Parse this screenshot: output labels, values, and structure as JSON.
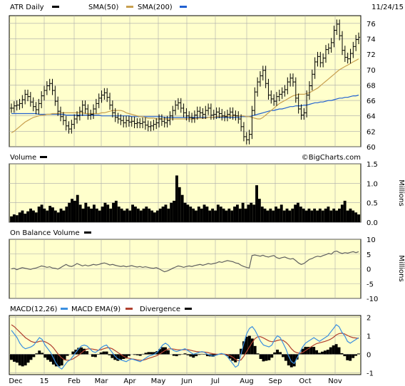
{
  "chart_data": {
    "type": "stock-panels",
    "date": "11/24/15",
    "credit": "©BigCharts.com",
    "x_tick_labels": [
      "Dec",
      "15",
      "Feb",
      "Mar",
      "Apr",
      "May",
      "Jun",
      "Jul",
      "Aug",
      "Sep",
      "Oct",
      "Nov"
    ],
    "colors": {
      "bg": "#ffffcc",
      "price": "#000000",
      "sma50": "#c8a050",
      "sma200": "#2060d0",
      "obv": "#606060",
      "macd": "#3a8fe0",
      "ema9": "#b04030",
      "divergence": "#000000",
      "grid": "#aaaaaa"
    },
    "panels": [
      {
        "id": "price",
        "legend": [
          {
            "label": "ATR Daily",
            "color": "#000000"
          },
          {
            "label": "SMA(50)",
            "color": "#c8a050"
          },
          {
            "label": "SMA(200)",
            "color": "#2060d0"
          }
        ],
        "y_ticks": [
          "76",
          "74",
          "72",
          "70",
          "68",
          "66",
          "64",
          "62",
          "60"
        ],
        "ylim": [
          60,
          77
        ],
        "close": [
          65.0,
          65.3,
          65.4,
          65.6,
          66.1,
          66.8,
          66.5,
          65.8,
          65.2,
          64.8,
          65.6,
          66.6,
          67.3,
          67.9,
          68.2,
          67.3,
          65.9,
          64.6,
          63.9,
          63.4,
          62.7,
          62.3,
          62.9,
          63.6,
          64.0,
          64.6,
          65.4,
          64.9,
          64.1,
          64.2,
          64.9,
          65.6,
          66.3,
          66.7,
          67.0,
          66.4,
          65.4,
          64.4,
          63.8,
          63.6,
          63.4,
          63.1,
          63.4,
          63.2,
          63.3,
          63.0,
          63.1,
          63.0,
          63.2,
          62.8,
          62.6,
          62.7,
          62.9,
          63.1,
          63.6,
          63.3,
          63.1,
          63.4,
          64.0,
          64.7,
          65.4,
          65.7,
          65.0,
          64.4,
          64.0,
          63.8,
          63.7,
          64.1,
          64.6,
          64.4,
          64.2,
          64.7,
          65.0,
          64.1,
          64.2,
          64.5,
          64.3,
          64.0,
          63.9,
          64.2,
          64.5,
          64.1,
          64.0,
          63.6,
          62.6,
          61.3,
          60.9,
          61.6,
          64.7,
          67.1,
          68.4,
          69.2,
          69.9,
          68.2,
          66.7,
          66.2,
          65.9,
          66.5,
          66.8,
          67.1,
          67.4,
          68.4,
          68.9,
          68.4,
          66.3,
          64.9,
          64.1,
          64.4,
          66.7,
          67.9,
          69.4,
          71.0,
          71.7,
          70.9,
          71.5,
          72.6,
          72.8,
          73.5,
          75.1,
          75.9,
          74.4,
          72.5,
          71.6,
          71.4,
          72.1,
          73.0,
          73.9,
          74.2
        ],
        "sma50": [
          61.8,
          62.0,
          62.3,
          62.6,
          62.9,
          63.2,
          63.4,
          63.6,
          63.8,
          63.9,
          64.0,
          64.1,
          64.1,
          64.2,
          64.2,
          64.3,
          64.3,
          64.3,
          64.4,
          64.4,
          64.4,
          64.4,
          64.4,
          64.4,
          64.4,
          64.4,
          64.4,
          64.3,
          64.3,
          64.3,
          64.3,
          64.3,
          64.3,
          64.4,
          64.4,
          64.5,
          64.6,
          64.7,
          64.7,
          64.7,
          64.7,
          64.6,
          64.4,
          64.3,
          64.2,
          64.1,
          64.0,
          63.9,
          63.9,
          63.8,
          63.7,
          63.7,
          63.7,
          63.6,
          63.6,
          63.6,
          63.6,
          63.6,
          63.6,
          63.6,
          63.6,
          63.6,
          63.6,
          63.6,
          63.6,
          63.6,
          63.6,
          63.6,
          63.7,
          63.7,
          63.7,
          63.7,
          63.8,
          63.8,
          63.8,
          63.9,
          63.9,
          63.9,
          64.0,
          64.0,
          64.0,
          64.0,
          64.0,
          64.0,
          64.0,
          64.0,
          63.9,
          63.9,
          63.8,
          63.7,
          63.6,
          63.6,
          63.8,
          64.1,
          64.4,
          64.7,
          65.0,
          65.3,
          65.6,
          65.8,
          66.0,
          66.2,
          66.4,
          66.6,
          66.7,
          66.8,
          66.8,
          66.8,
          66.9,
          67.0,
          67.2,
          67.4,
          67.6,
          67.9,
          68.2,
          68.5,
          68.8,
          69.1,
          69.4,
          69.7,
          70.0,
          70.2,
          70.4,
          70.6,
          70.8,
          71.0,
          71.2,
          71.4
        ],
        "sma200": [
          64.3,
          64.3,
          64.3,
          64.3,
          64.3,
          64.3,
          64.3,
          64.3,
          64.3,
          64.3,
          64.2,
          64.2,
          64.2,
          64.2,
          64.2,
          64.2,
          64.2,
          64.2,
          64.2,
          64.2,
          64.1,
          64.1,
          64.1,
          64.1,
          64.1,
          64.1,
          64.1,
          64.1,
          64.1,
          64.1,
          64.1,
          64.1,
          64.1,
          64.0,
          64.0,
          64.0,
          64.0,
          64.0,
          64.0,
          64.0,
          64.0,
          64.0,
          64.0,
          64.0,
          63.9,
          63.9,
          63.9,
          63.9,
          63.9,
          63.9,
          63.9,
          63.9,
          63.9,
          63.9,
          63.9,
          63.9,
          63.8,
          63.8,
          63.8,
          63.8,
          63.8,
          63.8,
          63.8,
          63.8,
          63.8,
          63.8,
          63.8,
          63.8,
          63.8,
          63.8,
          63.8,
          63.8,
          63.8,
          63.8,
          63.8,
          63.8,
          63.8,
          63.8,
          63.8,
          63.8,
          63.8,
          63.8,
          63.8,
          63.8,
          63.9,
          63.9,
          63.9,
          63.9,
          64.0,
          64.1,
          64.2,
          64.3,
          64.4,
          64.5,
          64.6,
          64.7,
          64.7,
          64.8,
          64.9,
          64.9,
          65.0,
          65.1,
          65.2,
          65.2,
          65.3,
          65.3,
          65.3,
          65.4,
          65.4,
          65.5,
          65.6,
          65.7,
          65.7,
          65.8,
          65.8,
          65.9,
          66.0,
          66.0,
          66.1,
          66.2,
          66.3,
          66.3,
          66.4,
          66.4,
          66.5,
          66.6,
          66.6,
          66.7
        ]
      },
      {
        "id": "volume",
        "legend": [
          {
            "label": "Volume",
            "color": "#000000"
          }
        ],
        "unit": "Millions",
        "y_ticks": [
          "1.5",
          "1.0",
          "0.5",
          "0.0"
        ],
        "ylim": [
          0,
          1.5
        ],
        "values": [
          0.15,
          0.2,
          0.18,
          0.25,
          0.3,
          0.22,
          0.28,
          0.35,
          0.3,
          0.25,
          0.4,
          0.45,
          0.35,
          0.3,
          0.42,
          0.38,
          0.3,
          0.25,
          0.35,
          0.3,
          0.4,
          0.5,
          0.6,
          0.55,
          0.7,
          0.45,
          0.35,
          0.5,
          0.4,
          0.35,
          0.45,
          0.35,
          0.3,
          0.4,
          0.5,
          0.45,
          0.35,
          0.5,
          0.55,
          0.4,
          0.35,
          0.3,
          0.35,
          0.3,
          0.45,
          0.4,
          0.35,
          0.3,
          0.35,
          0.4,
          0.35,
          0.3,
          0.25,
          0.3,
          0.35,
          0.4,
          0.45,
          0.35,
          0.5,
          0.55,
          1.2,
          0.9,
          0.7,
          0.5,
          0.45,
          0.4,
          0.35,
          0.3,
          0.4,
          0.35,
          0.45,
          0.4,
          0.3,
          0.35,
          0.3,
          0.45,
          0.4,
          0.35,
          0.3,
          0.35,
          0.3,
          0.4,
          0.45,
          0.35,
          0.5,
          0.35,
          0.45,
          0.5,
          0.45,
          0.95,
          0.6,
          0.4,
          0.35,
          0.3,
          0.35,
          0.3,
          0.4,
          0.35,
          0.45,
          0.3,
          0.35,
          0.3,
          0.35,
          0.45,
          0.5,
          0.4,
          0.35,
          0.3,
          0.35,
          0.3,
          0.35,
          0.3,
          0.35,
          0.3,
          0.35,
          0.4,
          0.3,
          0.35,
          0.3,
          0.35,
          0.45,
          0.55,
          0.3,
          0.35,
          0.3,
          0.25,
          0.2
        ]
      },
      {
        "id": "obv",
        "legend": [
          {
            "label": "On Balance Volume",
            "color": "#000000"
          }
        ],
        "unit": "Millions",
        "y_ticks": [
          "10",
          "5",
          "0",
          "-5",
          "-10"
        ],
        "ylim": [
          -10,
          10
        ],
        "values": [
          0,
          0.2,
          -0.3,
          0.1,
          0.4,
          0.2,
          0,
          -0.2,
          0.1,
          0.3,
          0.6,
          1.0,
          0.8,
          0.5,
          0.7,
          0.3,
          0.2,
          -0.1,
          0.4,
          1.0,
          1.5,
          1.0,
          0.8,
          1.2,
          1.8,
          1.4,
          1.0,
          1.3,
          1.0,
          1.2,
          1.5,
          1.3,
          1.5,
          1.8,
          2.0,
          1.7,
          1.3,
          1.5,
          1.2,
          1.0,
          0.8,
          1.0,
          0.7,
          0.9,
          1.1,
          0.8,
          0.6,
          0.8,
          0.5,
          0.7,
          0.5,
          0.3,
          0.2,
          0.4,
          0.0,
          -0.5,
          -1.0,
          -0.7,
          -0.3,
          0.2,
          0.6,
          1.0,
          0.8,
          0.5,
          0.8,
          1.0,
          0.8,
          1.1,
          1.3,
          1.5,
          1.2,
          1.5,
          1.8,
          1.6,
          1.8,
          2.0,
          2.4,
          2.2,
          2.5,
          2.8,
          2.6,
          2.4,
          2.0,
          1.8,
          1.2,
          0.8,
          0.5,
          0.3,
          4.5,
          4.7,
          4.5,
          4.3,
          4.6,
          4.2,
          4.0,
          4.3,
          4.5,
          3.8,
          3.5,
          3.8,
          4.0,
          3.6,
          3.3,
          3.5,
          2.8,
          2.0,
          1.5,
          1.8,
          2.5,
          3.2,
          3.5,
          4.0,
          4.3,
          4.1,
          4.5,
          4.8,
          5.2,
          5.0,
          5.8,
          6.0,
          5.5,
          5.2,
          5.5,
          5.3,
          5.6,
          5.8,
          5.5,
          5.8
        ]
      },
      {
        "id": "macd",
        "legend": [
          {
            "label": "MACD(12,26)",
            "color": "#3a8fe0"
          },
          {
            "label": "MACD EMA(9)",
            "color": "#b04030"
          },
          {
            "label": "Divergence",
            "color": "#000000"
          }
        ],
        "y_ticks": [
          "2",
          "1",
          "0",
          "-1"
        ],
        "ylim": [
          -1.1,
          2.1
        ],
        "macd": [
          1.3,
          1.1,
          0.9,
          0.6,
          0.4,
          0.3,
          0.35,
          0.4,
          0.5,
          0.7,
          0.9,
          0.8,
          0.5,
          0.3,
          0.1,
          -0.2,
          -0.5,
          -0.7,
          -0.8,
          -0.6,
          -0.4,
          -0.3,
          -0.1,
          0.1,
          0.3,
          0.45,
          0.5,
          0.45,
          0.3,
          0.15,
          0.1,
          0.2,
          0.35,
          0.45,
          0.5,
          0.3,
          0.1,
          -0.1,
          -0.25,
          -0.3,
          -0.35,
          -0.4,
          -0.3,
          -0.25,
          -0.3,
          -0.35,
          -0.4,
          -0.3,
          -0.2,
          -0.1,
          -0.05,
          0.0,
          0.1,
          0.3,
          0.5,
          0.6,
          0.5,
          0.3,
          0.2,
          0.15,
          0.2,
          0.25,
          0.3,
          0.2,
          0.1,
          0.0,
          0.05,
          0.1,
          0.15,
          0.1,
          0.0,
          -0.05,
          -0.1,
          -0.05,
          0.0,
          0.05,
          0.0,
          -0.1,
          -0.3,
          -0.5,
          -0.7,
          -0.6,
          0.0,
          0.6,
          1.1,
          1.4,
          1.5,
          1.3,
          1.0,
          0.7,
          0.5,
          0.45,
          0.4,
          0.5,
          0.8,
          1.0,
          0.9,
          0.6,
          0.3,
          -0.1,
          -0.4,
          -0.5,
          -0.2,
          0.1,
          0.4,
          0.6,
          0.7,
          0.8,
          0.9,
          0.8,
          0.7,
          0.8,
          0.9,
          1.0,
          1.2,
          1.4,
          1.6,
          1.5,
          1.2,
          1.0,
          0.7,
          0.6,
          0.7,
          0.8,
          0.9
        ],
        "ema9": [
          1.6,
          1.5,
          1.35,
          1.2,
          1.05,
          0.9,
          0.8,
          0.7,
          0.65,
          0.65,
          0.7,
          0.72,
          0.68,
          0.6,
          0.5,
          0.35,
          0.15,
          -0.05,
          -0.2,
          -0.3,
          -0.32,
          -0.3,
          -0.25,
          -0.15,
          -0.05,
          0.08,
          0.2,
          0.28,
          0.3,
          0.28,
          0.25,
          0.22,
          0.25,
          0.3,
          0.35,
          0.35,
          0.3,
          0.2,
          0.1,
          0.0,
          -0.1,
          -0.18,
          -0.22,
          -0.25,
          -0.27,
          -0.3,
          -0.32,
          -0.32,
          -0.28,
          -0.22,
          -0.17,
          -0.12,
          -0.07,
          0.02,
          0.12,
          0.22,
          0.28,
          0.3,
          0.28,
          0.25,
          0.24,
          0.24,
          0.25,
          0.25,
          0.22,
          0.18,
          0.15,
          0.13,
          0.13,
          0.12,
          0.1,
          0.06,
          0.03,
          0.01,
          0.0,
          0.01,
          0.01,
          -0.01,
          -0.07,
          -0.15,
          -0.27,
          -0.35,
          -0.3,
          -0.1,
          0.15,
          0.4,
          0.65,
          0.85,
          0.95,
          0.95,
          0.88,
          0.8,
          0.72,
          0.68,
          0.7,
          0.75,
          0.78,
          0.75,
          0.65,
          0.5,
          0.3,
          0.15,
          0.08,
          0.06,
          0.1,
          0.2,
          0.3,
          0.4,
          0.5,
          0.58,
          0.62,
          0.66,
          0.7,
          0.75,
          0.82,
          0.92,
          1.05,
          1.12,
          1.14,
          1.1,
          1.02,
          0.95,
          0.9,
          0.88,
          0.86
        ]
      }
    ]
  }
}
